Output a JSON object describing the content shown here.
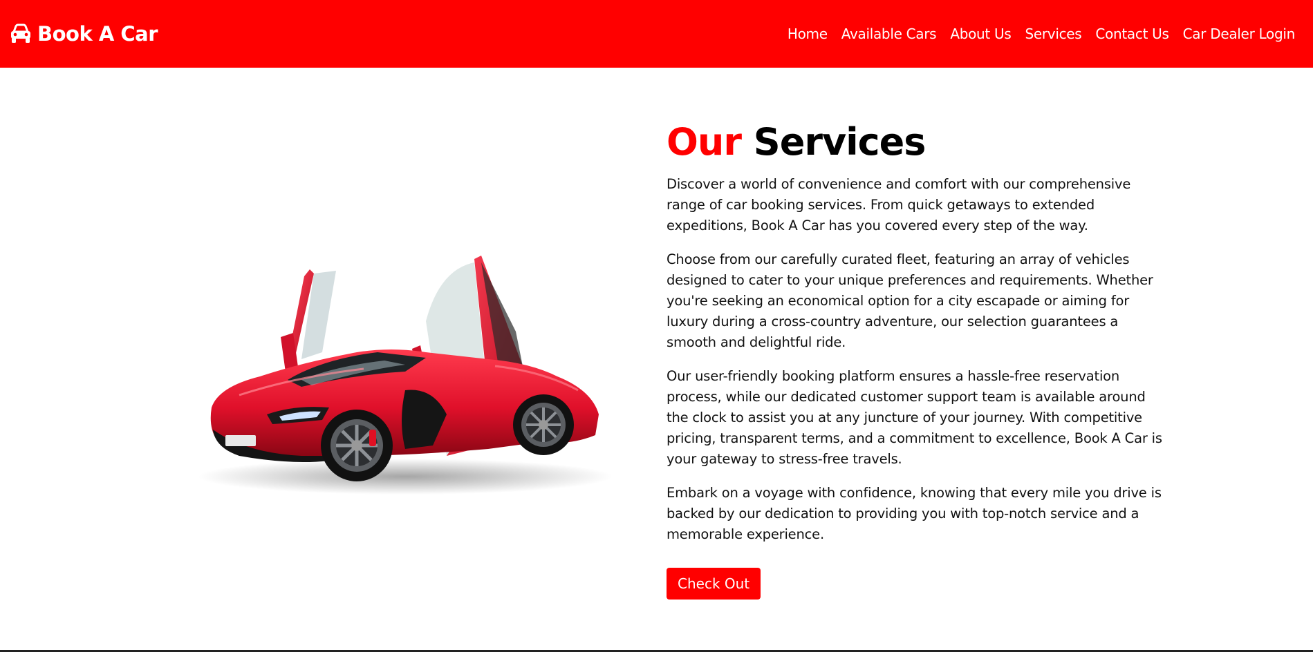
{
  "navbar": {
    "brand_text": "Book A Car",
    "brand_icon": "car-icon",
    "links": [
      {
        "label": "Home"
      },
      {
        "label": "Available Cars"
      },
      {
        "label": "About Us"
      },
      {
        "label": "Services"
      },
      {
        "label": "Contact Us"
      },
      {
        "label": "Car Dealer Login"
      }
    ]
  },
  "services": {
    "title_accent": "Our",
    "title_rest": "Services",
    "paragraphs": [
      "Discover a world of convenience and comfort with our comprehensive range of car booking services. From quick getaways to extended expeditions, Book A Car has you covered every step of the way.",
      "Choose from our carefully curated fleet, featuring an array of vehicles designed to cater to your unique preferences and requirements. Whether you're seeking an economical option for a city escapade or aiming for luxury during a cross-country adventure, our selection guarantees a smooth and delightful ride.",
      "Our user-friendly booking platform ensures a hassle-free reservation process, while our dedicated customer support team is available around the clock to assist you at any juncture of your journey. With competitive pricing, transparent terms, and a commitment to excellence, Book A Car is your gateway to stress-free travels.",
      "Embark on a voyage with confidence, knowing that every mile you drive is backed by our dedication to providing you with top-notch service and a memorable experience."
    ],
    "cta_label": "Check Out"
  },
  "colors": {
    "brand": "#ff0000",
    "text": "#111111",
    "background": "#ffffff"
  }
}
